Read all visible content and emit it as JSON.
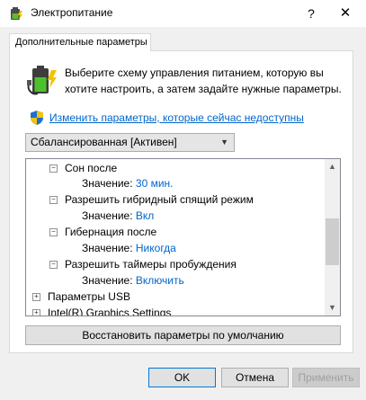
{
  "window": {
    "title": "Электропитание",
    "help_glyph": "?",
    "close_glyph": "✕"
  },
  "tab": {
    "label": "Дополнительные параметры"
  },
  "description": "Выберите схему управления питанием, которую вы хотите настроить, а затем задайте нужные параметры.",
  "change_link": "Изменить параметры, которые сейчас недоступны",
  "plan_select": {
    "value": "Сбалансированная [Активен]"
  },
  "tree": {
    "items": [
      {
        "label": "Сон после",
        "expander": "⊟"
      },
      {
        "label": "Значение:",
        "value": "30 мин."
      },
      {
        "label": "Разрешить гибридный спящий режим",
        "expander": "⊟"
      },
      {
        "label": "Значение:",
        "value": "Вкл"
      },
      {
        "label": "Гибернация после",
        "expander": "⊟"
      },
      {
        "label": "Значение:",
        "value": "Никогда"
      },
      {
        "label": "Разрешить таймеры пробуждения",
        "expander": "⊟"
      },
      {
        "label": "Значение:",
        "value": "Включить"
      },
      {
        "label": "Параметры USB",
        "expander": "⊞"
      },
      {
        "label": "Intel(R) Graphics Settings",
        "expander": "⊞"
      }
    ]
  },
  "buttons": {
    "restore": "Восстановить параметры по умолчанию",
    "ok": "OK",
    "cancel": "Отмена",
    "apply": "Применить"
  }
}
